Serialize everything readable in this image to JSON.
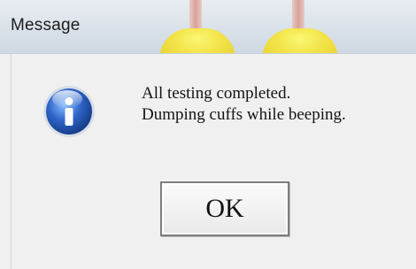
{
  "window": {
    "title": "Message"
  },
  "dialog": {
    "icon": "info-icon",
    "message_line1": "All testing completed.",
    "message_line2": "Dumping cuffs while beeping.",
    "ok_label": "OK"
  },
  "colors": {
    "titlebar": "#dce3ea",
    "dialog_bg": "#f0f0f0",
    "info_icon_blue": "#2f62c9"
  }
}
